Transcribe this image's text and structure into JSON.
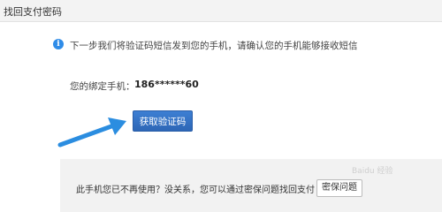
{
  "dialog": {
    "title": "找回支付密码"
  },
  "info": {
    "icon": "info-icon",
    "message": "下一步我们将验证码短信发到您的手机，请确认您的手机能够接收短信"
  },
  "phone": {
    "label": "您的绑定手机：",
    "value": "186******60"
  },
  "buttons": {
    "get_code": "获取验证码",
    "security_question": "密保问题"
  },
  "bottom": {
    "message": "此手机您已不再使用？没关系，您可以通过密保问题找回支付"
  },
  "watermark": {
    "text": "Baidu 经验"
  },
  "colors": {
    "accent": "#2d66b6",
    "info_icon": "#2f8ce8",
    "arrow": "#2b8de0"
  }
}
